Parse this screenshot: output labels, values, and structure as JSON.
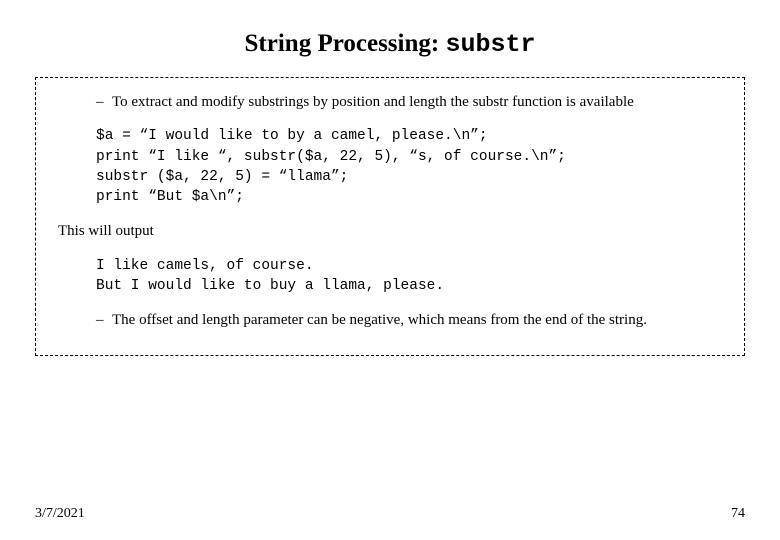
{
  "title": {
    "text": "String Processing: ",
    "code": "substr"
  },
  "bullets": [
    "To extract and modify substrings by position and length the substr function is available",
    "The offset and length parameter can be negative, which means from the end of the string."
  ],
  "code1": "$a = “I would like to by a camel, please.\\n”;\nprint “I like “, substr($a, 22, 5), “s, of course.\\n”;\nsubstr ($a, 22, 5) = “llama”;\nprint “But $a\\n”;",
  "output_intro": "This will output",
  "output": "I like camels, of course.\nBut I would like to buy a llama, please.",
  "footer": {
    "date": "3/7/2021",
    "page": "74"
  }
}
